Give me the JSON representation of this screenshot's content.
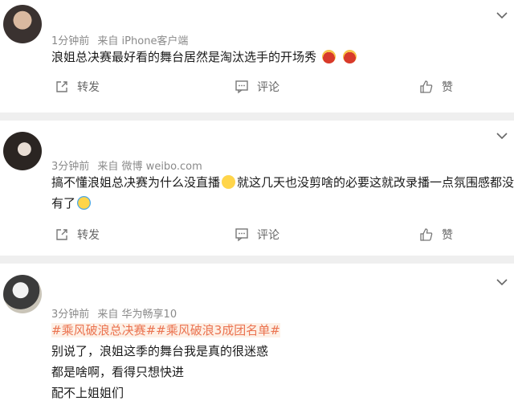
{
  "comments": [
    {
      "time": "1分钟前",
      "source": "来自 iPhone客户端",
      "text": "浪姐总决赛最好看的舞台居然是淘汰选手的开场秀",
      "emoji": [
        "red-envelope-emoji",
        "red-envelope-emoji"
      ],
      "actions": {
        "repost": "转发",
        "comment": "评论",
        "like": "赞"
      }
    },
    {
      "time": "3分钟前",
      "source": "来自 微博 weibo.com",
      "text_line1a": "搞不懂浪姐总决赛为什么没直播",
      "text_line1b": "就这几天也没剪啥的必要这就改录播一点氛围感都没",
      "text_line2": "有了",
      "emoji": [
        "sad-face-emoji",
        "crying-laughing-emoji"
      ],
      "actions": {
        "repost": "转发",
        "comment": "评论",
        "like": "赞"
      }
    },
    {
      "time": "3分钟前",
      "source": "来自 华为畅享10",
      "hashtag1": "#乘风破浪总决赛#",
      "hashtag2": "#乘风破浪3成团名单#",
      "lines": [
        "别说了，浪姐这季的舞台我是真的很迷惑",
        "都是啥啊，看得只想快进",
        "配不上姐姐们"
      ]
    }
  ],
  "colors": {
    "hashtag": "#eb7350",
    "divider": "#efefef",
    "meta": "#8a8a8a"
  }
}
